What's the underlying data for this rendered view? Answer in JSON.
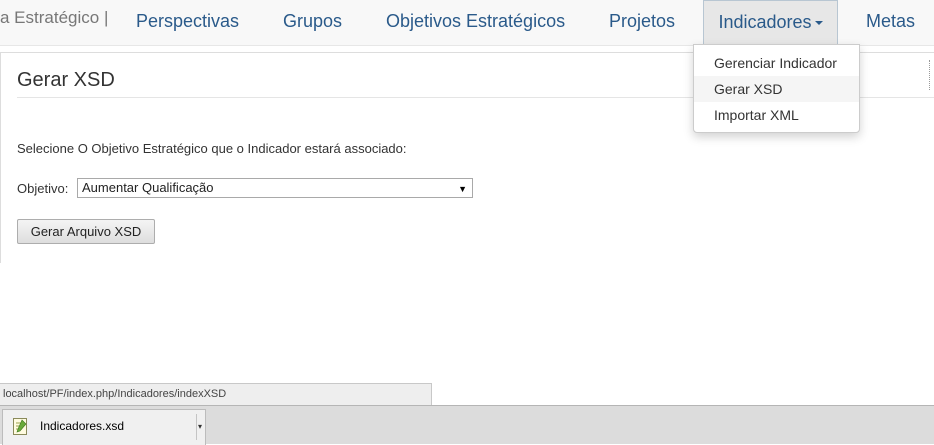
{
  "navbar": {
    "brand": "a Estratégico |",
    "items": [
      {
        "label": "Perspectivas"
      },
      {
        "label": "Grupos"
      },
      {
        "label": "Objetivos Estratégicos"
      },
      {
        "label": "Projetos"
      },
      {
        "label": "Indicadores"
      },
      {
        "label": "Metas"
      }
    ]
  },
  "dropdown": {
    "items": [
      {
        "label": "Gerenciar Indicador"
      },
      {
        "label": "Gerar XSD"
      },
      {
        "label": "Importar XML"
      }
    ]
  },
  "main": {
    "title": "Gerar XSD",
    "instruction": "Selecione O Objetivo Estratégico que o Indicador estará associado:",
    "objetivo_label": "Objetivo:",
    "objetivo_selected": "Aumentar Qualificação",
    "select_arrow": "▼",
    "generate_button": "Gerar Arquivo XSD"
  },
  "status_url": "localhost/PF/index.php/Indicadores/indexXSD",
  "download": {
    "file_name": "Indicadores.xsd",
    "menu_glyph": "▾"
  },
  "colors": {
    "nav_link": "#2a5a8a",
    "active_tab_bg": "#e7e7e7",
    "dropdown_hover": "#f5f5f5"
  }
}
